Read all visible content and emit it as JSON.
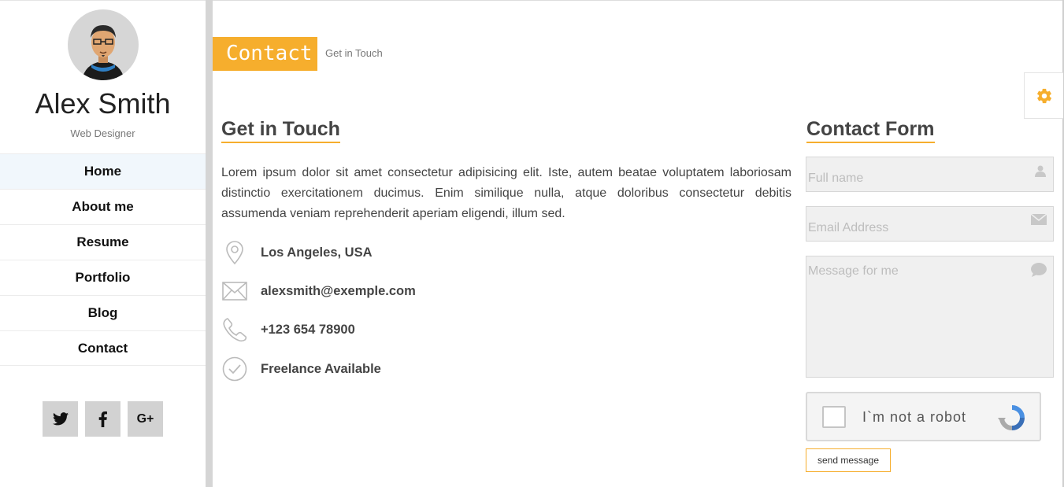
{
  "profile": {
    "name": "Alex Smith",
    "role": "Web Designer"
  },
  "nav": {
    "items": [
      "Home",
      "About me",
      "Resume",
      "Portfolio",
      "Blog",
      "Contact"
    ],
    "active": "Home"
  },
  "social": {
    "icons": [
      "twitter-icon",
      "facebook-icon",
      "google-plus-icon"
    ],
    "gplus_label": "G+"
  },
  "section": {
    "title": "Contact",
    "subtitle": "Get in Touch"
  },
  "touch": {
    "heading": "Get in Touch",
    "intro": "Lorem ipsum dolor sit amet consectetur adipisicing elit. Iste, autem beatae voluptatem laboriosam distinctio exercitationem ducimus. Enim similique nulla, atque doloribus consectetur debitis assumenda veniam reprehenderit aperiam eligendi, illum sed.",
    "location": "Los Angeles, USA",
    "email": "alexsmith@exemple.com",
    "phone": "+123 654 78900",
    "availability": "Freelance Available"
  },
  "form": {
    "heading": "Contact Form",
    "name_placeholder": "Full name",
    "email_placeholder": "Email Address",
    "message_placeholder": "Message for me",
    "captcha_label": "I`m not a robot",
    "submit_label": "send message"
  },
  "colors": {
    "accent": "#f6ae2d",
    "sidebar_divider": "#d5d5d5",
    "field_bg": "#f0f0f0"
  }
}
